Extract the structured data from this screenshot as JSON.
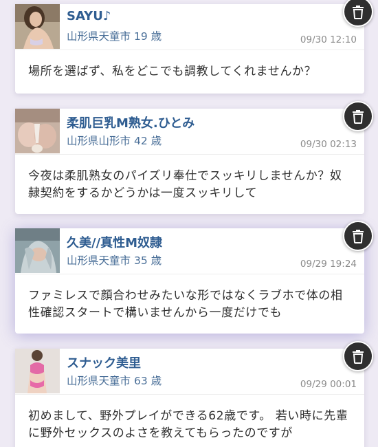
{
  "posts": [
    {
      "name": "SAYU♪",
      "prefecture": "山形県天童市",
      "age": "19 歳",
      "timestamp": "09/30 12:10",
      "message": "場所を選ばず、私をどこでも調教してくれませんか？",
      "delete_icon": "trash-icon"
    },
    {
      "name": "柔肌巨乳M熟女.ひとみ",
      "prefecture": "山形県山形市",
      "age": "42 歳",
      "timestamp": "09/30 02:13",
      "message": "今夜は柔肌熟女のパイズリ奉仕でスッキリしませんか？奴隷契約をするかどうかは一度スッキリして",
      "delete_icon": "trash-icon"
    },
    {
      "name": "久美//真性M奴隷",
      "prefecture": "山形県天童市",
      "age": "35 歳",
      "timestamp": "09/29 19:24",
      "message": "ファミレスで顔合わせみたいな形ではなくラブホで体の相性確認スタートで構いませんから一度だけでも",
      "delete_icon": "trash-icon"
    },
    {
      "name": "スナック美里",
      "prefecture": "山形県天童市",
      "age": "63 歳",
      "timestamp": "09/29 00:01",
      "message": "初めまして、野外プレイができる62歳です。 若い時に先輩に野外セックスのよさを教えてもらったのですが",
      "delete_icon": "trash-icon"
    }
  ],
  "colors": {
    "name": "#2f5d91",
    "location": "#4a6f98",
    "timestamp": "#8a8a8a",
    "background": "#eeeaf4",
    "delete_button": "#2f2f2f"
  }
}
